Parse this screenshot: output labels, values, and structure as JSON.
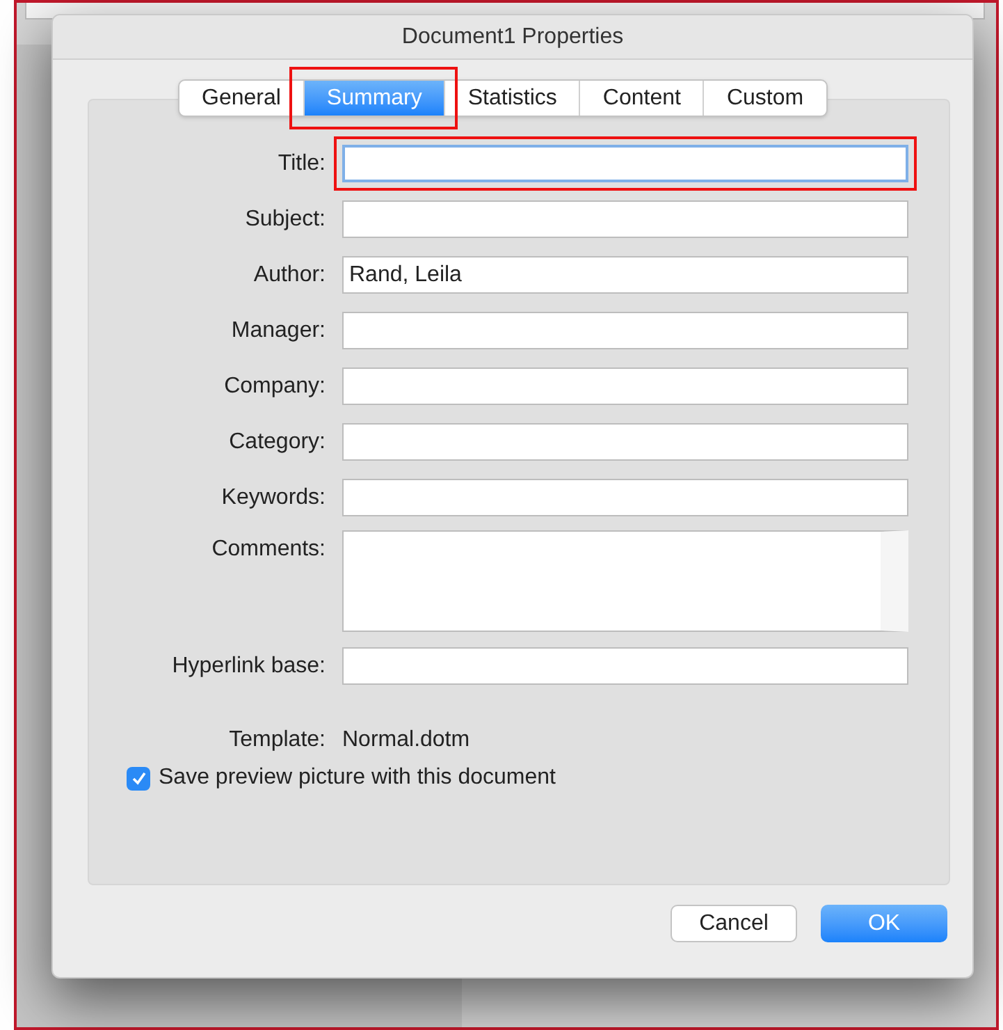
{
  "window": {
    "title": "Document1 Properties"
  },
  "tabs": [
    {
      "label": "General",
      "selected": false,
      "annotated": false
    },
    {
      "label": "Summary",
      "selected": true,
      "annotated": true
    },
    {
      "label": "Statistics",
      "selected": false,
      "annotated": false
    },
    {
      "label": "Content",
      "selected": false,
      "annotated": false
    },
    {
      "label": "Custom",
      "selected": false,
      "annotated": false
    }
  ],
  "fields": [
    {
      "kind": "text",
      "label": "Title:",
      "focused": true,
      "annotated": true
    },
    {
      "kind": "text",
      "label": "Subject:",
      "focused": false,
      "annotated": false
    },
    {
      "kind": "text",
      "label": "Author:",
      "value": "Rand, Leila",
      "focused": false,
      "annotated": false
    },
    {
      "kind": "text",
      "label": "Manager:",
      "focused": false,
      "annotated": false
    },
    {
      "kind": "text",
      "label": "Company:",
      "focused": false,
      "annotated": false
    },
    {
      "kind": "text",
      "label": "Category:",
      "focused": false,
      "annotated": false
    },
    {
      "kind": "text",
      "label": "Keywords:",
      "focused": false,
      "annotated": false
    },
    {
      "kind": "multiline",
      "label": "Comments:",
      "focused": false,
      "annotated": false
    },
    {
      "kind": "text",
      "label": "Hyperlink base:",
      "focused": false,
      "annotated": false
    },
    {
      "kind": "static",
      "label": "Template:",
      "value": "Normal.dotm"
    }
  ],
  "save_preview": {
    "label": "Save preview picture with this document",
    "checked": true
  },
  "buttons": [
    {
      "label": "Cancel",
      "default": false
    },
    {
      "label": "OK",
      "default": true
    }
  ]
}
